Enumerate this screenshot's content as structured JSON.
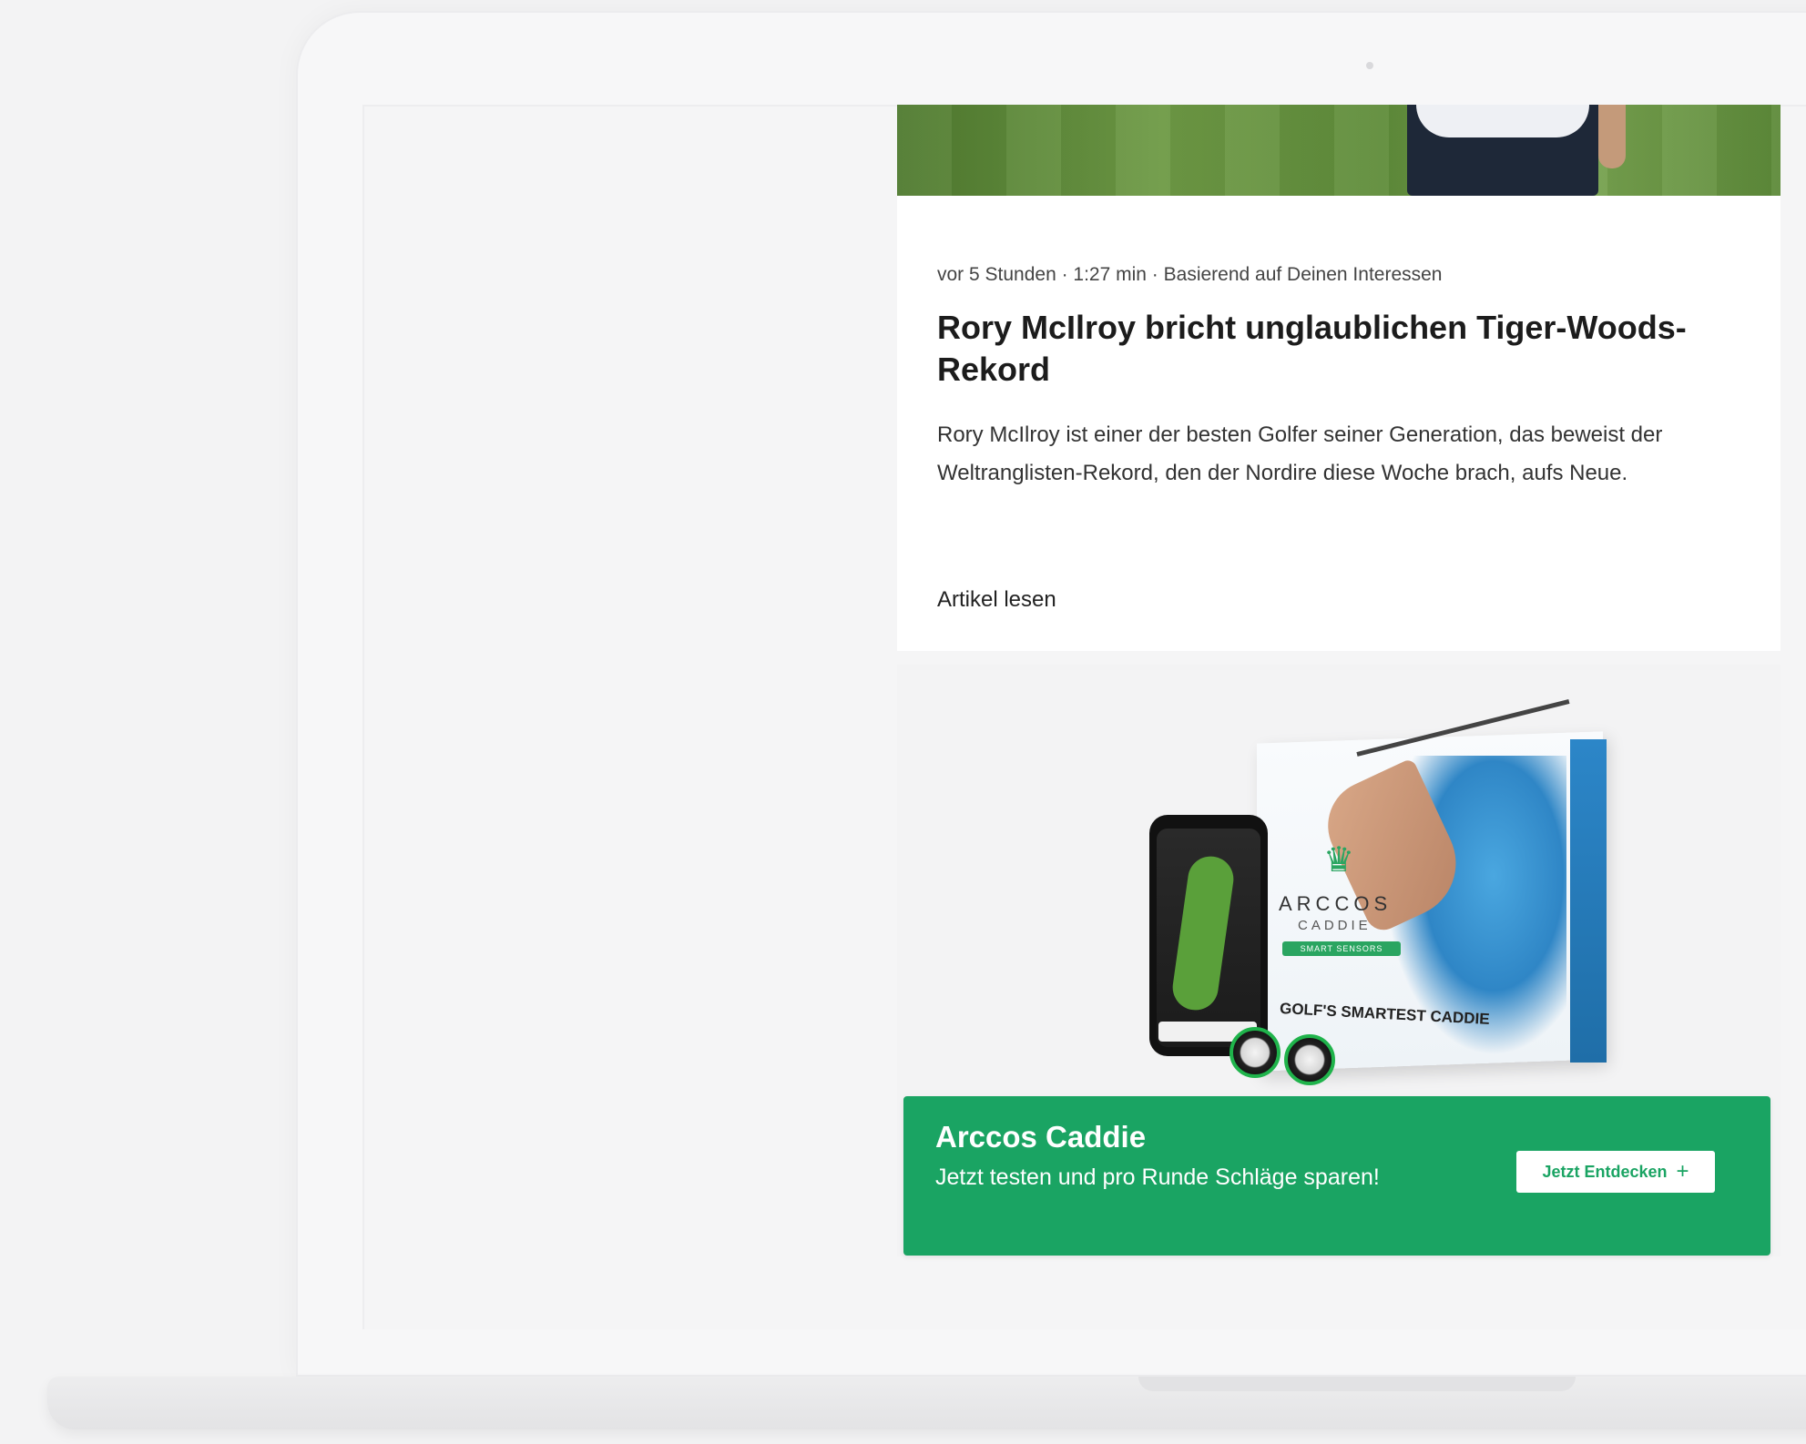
{
  "article": {
    "meta": "vor 5 Stunden · 1:27 min · Basierend auf Deinen Interessen",
    "headline": "Rory McIlroy bricht unglaublichen Tiger-Woods-Rekord",
    "teaser": "Rory McIlroy ist einer der besten Golfer seiner Generation, das beweist der Weltranglisten-Rekord, den der Nordire diese Woche brach, aufs Neue.",
    "read_link": "Artikel lesen"
  },
  "ad": {
    "title": "Arccos Caddie",
    "text": "Jetzt testen und pro Runde Schläge sparen!",
    "cta_label": "Jetzt Entdecken",
    "cta_icon": "plus-icon",
    "accent_color": "#1aa463",
    "product": {
      "brand_name": "ARCCOS",
      "brand_sub": "CADDIE",
      "pill": "SMART SENSORS",
      "tagline": "GOLF'S SMARTEST CADDIE"
    }
  }
}
